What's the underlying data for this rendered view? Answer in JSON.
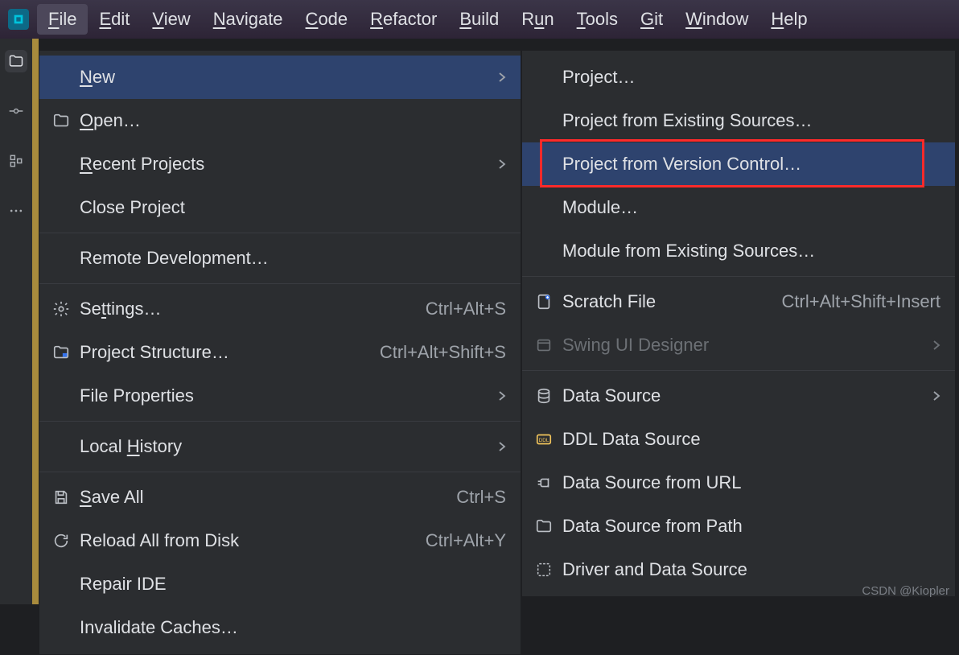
{
  "menubar": {
    "items": [
      {
        "label": "File",
        "mnemonic": "F",
        "rest": "ile"
      },
      {
        "label": "Edit",
        "mnemonic": "E",
        "rest": "dit"
      },
      {
        "label": "View",
        "mnemonic": "V",
        "rest": "iew"
      },
      {
        "label": "Navigate",
        "mnemonic": "N",
        "rest": "avigate"
      },
      {
        "label": "Code",
        "mnemonic": "C",
        "rest": "ode"
      },
      {
        "label": "Refactor",
        "mnemonic": "R",
        "rest": "efactor"
      },
      {
        "label": "Build",
        "mnemonic": "B",
        "rest": "uild"
      },
      {
        "label": "Run",
        "pre": "R",
        "mnemonic": "u",
        "rest": "n"
      },
      {
        "label": "Tools",
        "mnemonic": "T",
        "rest": "ools"
      },
      {
        "label": "Git",
        "mnemonic": "G",
        "rest": "it"
      },
      {
        "label": "Window",
        "mnemonic": "W",
        "rest": "indow"
      },
      {
        "label": "Help",
        "mnemonic": "H",
        "rest": "elp"
      }
    ],
    "active_index": 0
  },
  "file_menu": {
    "items": [
      {
        "label": "New",
        "mnemonic": "N",
        "rest": "ew",
        "arrow": true,
        "selected": true
      },
      {
        "label": "Open…",
        "mnemonic": "O",
        "rest": "pen…",
        "icon": "folder"
      },
      {
        "label": "Recent Projects",
        "mnemonic": "R",
        "rest": "ecent Projects",
        "arrow": true
      },
      {
        "label": "Close Project"
      },
      {
        "sep": true
      },
      {
        "label": "Remote Development…"
      },
      {
        "sep": true
      },
      {
        "label": "Settings…",
        "pre": "Se",
        "mnemonic": "t",
        "rest": "tings…",
        "icon": "gear",
        "shortcut": "Ctrl+Alt+S"
      },
      {
        "label": "Project Structure…",
        "icon": "project-structure",
        "shortcut": "Ctrl+Alt+Shift+S"
      },
      {
        "label": "File Properties",
        "arrow": true
      },
      {
        "sep": true
      },
      {
        "label": "Local History",
        "pre": "Local ",
        "mnemonic": "H",
        "rest": "istory",
        "arrow": true
      },
      {
        "sep": true
      },
      {
        "label": "Save All",
        "mnemonic": "S",
        "rest": "ave All",
        "icon": "save",
        "shortcut": "Ctrl+S"
      },
      {
        "label": "Reload All from Disk",
        "icon": "reload",
        "shortcut": "Ctrl+Alt+Y"
      },
      {
        "label": "Repair IDE"
      },
      {
        "label": "Invalidate Caches…"
      }
    ]
  },
  "new_submenu": {
    "items": [
      {
        "label": "Project…"
      },
      {
        "label": "Project from Existing Sources…"
      },
      {
        "label": "Project from Version Control…",
        "selected": true,
        "highlight": true
      },
      {
        "label": "Module…"
      },
      {
        "label": "Module from Existing Sources…"
      },
      {
        "sep": true
      },
      {
        "label": "Scratch File",
        "icon": "scratch",
        "shortcut": "Ctrl+Alt+Shift+Insert"
      },
      {
        "label": "Swing UI Designer",
        "icon": "swing",
        "arrow": true,
        "disabled": true
      },
      {
        "sep": true
      },
      {
        "label": "Data Source",
        "icon": "database",
        "arrow": true
      },
      {
        "label": "DDL Data Source",
        "icon": "ddl"
      },
      {
        "label": "Data Source from URL",
        "icon": "plug"
      },
      {
        "label": "Data Source from Path",
        "icon": "folder"
      },
      {
        "label": "Driver and Data Source",
        "icon": "driver"
      }
    ]
  },
  "watermark": "CSDN @Kiopler"
}
